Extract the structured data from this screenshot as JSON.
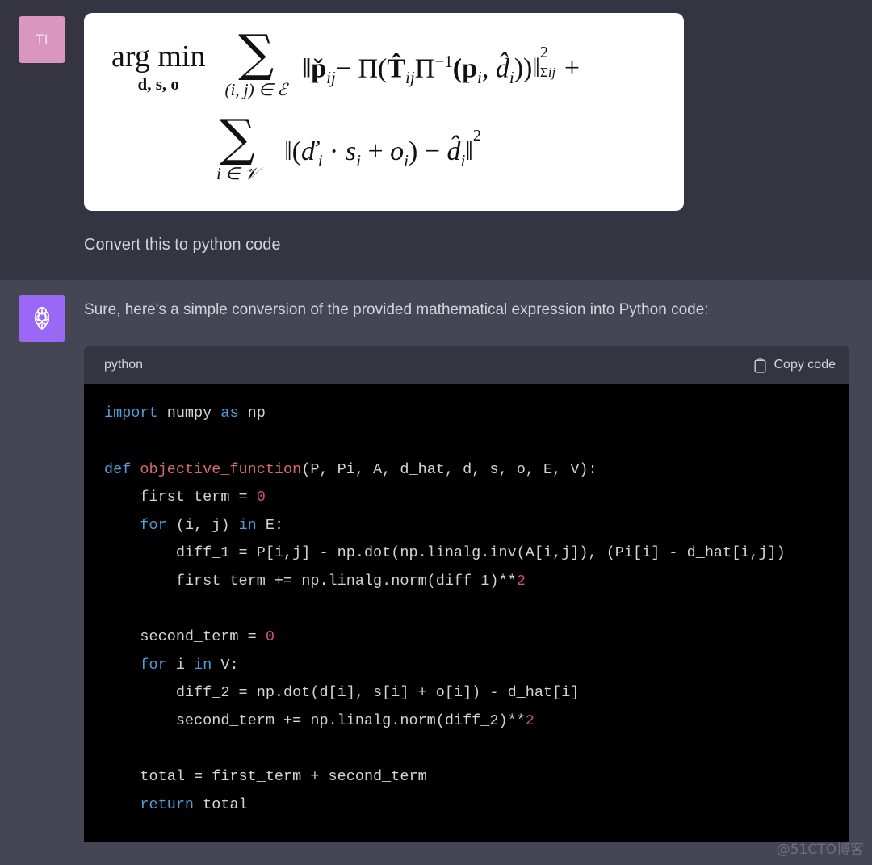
{
  "user_message": {
    "avatar_initials": "TI",
    "avatar_color": "#d996c0",
    "attachment": {
      "type": "equation-image",
      "background": "#ffffff",
      "line1": {
        "operator": "arg min",
        "operator_subscript": "d, s, o",
        "sum_symbol": "∑",
        "sum_subscript": "(i, j) ∈ ℰ",
        "expression": "‖p̌",
        "expr_sub_1": "ij",
        "minus": "− Π(",
        "T_term": "T̂",
        "T_sub": "ij",
        "pi_inv": "Π",
        "pi_inv_sup": "−1",
        "args": "(p",
        "arg_sub_1": "i",
        "comma": ", ",
        "d_hat": "d̂",
        "arg_sub_2": "i",
        "close": "))‖",
        "norm_sup": "2",
        "norm_sub": "Σ",
        "norm_sub_idx": "ij",
        "plus": "+"
      },
      "line2": {
        "sum_symbol": "∑",
        "sum_subscript": "i ∈ 𝒱",
        "open": "‖(",
        "d_check": "ď",
        "d_sub": "i",
        "dot": " · ",
        "s": "s",
        "s_sub": "i",
        "plus": " + ",
        "o": "o",
        "o_sub": "i",
        "close_paren": ") − ",
        "d_hat": "d̂",
        "d_hat_sub": "i",
        "norm_close": "‖",
        "norm_sup": "2"
      }
    },
    "text": "Convert this to python code"
  },
  "assistant_message": {
    "avatar_color": "#9a68f5",
    "avatar_icon": "openai-logo-icon",
    "text": "Sure, here's a simple conversion of the provided mathematical expression into Python code:",
    "code_block": {
      "language": "python",
      "copy_label": "Copy code",
      "copy_icon": "clipboard-icon",
      "lines": [
        [
          {
            "t": "import",
            "c": "kw"
          },
          {
            "t": " numpy ",
            "c": "pl"
          },
          {
            "t": "as",
            "c": "kw"
          },
          {
            "t": " np",
            "c": "pl"
          }
        ],
        [],
        [
          {
            "t": "def",
            "c": "kw"
          },
          {
            "t": " ",
            "c": "pl"
          },
          {
            "t": "objective_function",
            "c": "fn"
          },
          {
            "t": "(P, Pi, A, d_hat, d, s, o, E, V):",
            "c": "pl"
          }
        ],
        [
          {
            "t": "    first_term = ",
            "c": "pl"
          },
          {
            "t": "0",
            "c": "num"
          }
        ],
        [
          {
            "t": "    ",
            "c": "pl"
          },
          {
            "t": "for",
            "c": "kw"
          },
          {
            "t": " (i, j) ",
            "c": "pl"
          },
          {
            "t": "in",
            "c": "kw"
          },
          {
            "t": " E:",
            "c": "pl"
          }
        ],
        [
          {
            "t": "        diff_1 = P[i,j] - np.dot(np.linalg.inv(A[i,j]), (Pi[i] - d_hat[i,j])",
            "c": "pl"
          }
        ],
        [
          {
            "t": "        first_term += np.linalg.norm(diff_1)**",
            "c": "pl"
          },
          {
            "t": "2",
            "c": "num"
          }
        ],
        [],
        [
          {
            "t": "    second_term = ",
            "c": "pl"
          },
          {
            "t": "0",
            "c": "num"
          }
        ],
        [
          {
            "t": "    ",
            "c": "pl"
          },
          {
            "t": "for",
            "c": "kw"
          },
          {
            "t": " i ",
            "c": "pl"
          },
          {
            "t": "in",
            "c": "kw"
          },
          {
            "t": " V:",
            "c": "pl"
          }
        ],
        [
          {
            "t": "        diff_2 = np.dot(d[i], s[i] + o[i]) - d_hat[i]",
            "c": "pl"
          }
        ],
        [
          {
            "t": "        second_term += np.linalg.norm(diff_2)**",
            "c": "pl"
          },
          {
            "t": "2",
            "c": "num"
          }
        ],
        [],
        [
          {
            "t": "    total = first_term + second_term",
            "c": "pl"
          }
        ],
        [
          {
            "t": "    ",
            "c": "pl"
          },
          {
            "t": "return",
            "c": "kw"
          },
          {
            "t": " total",
            "c": "pl"
          }
        ]
      ]
    }
  },
  "watermark": "@51CTO博客",
  "colors": {
    "user_bg": "#343541",
    "assistant_bg": "#444654",
    "code_bg": "#000000",
    "code_header_bg": "#343541",
    "text": "#d1d5db",
    "keyword": "#569cd6",
    "function": "#d16b6b",
    "number": "#cf4f7e"
  }
}
